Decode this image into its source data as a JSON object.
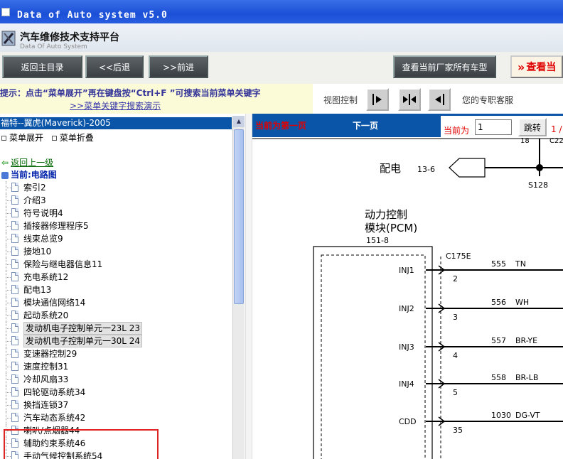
{
  "window": {
    "title": "Data of Auto system v5.0"
  },
  "header": {
    "title": "汽车维修技术支持平台",
    "subtitle": "Data Of Auto System"
  },
  "toolbar": {
    "home_label": "返回主目录",
    "back_label": "<<后退",
    "forward_label": ">>前进",
    "all_models_label": "查看当前厂家所有车型",
    "hot_label": "查看当"
  },
  "tips": {
    "hint": "提示：点击“菜单展开”再在键盘按“Ctrl+F ”可搜索当前菜单关键字",
    "demo_link": ">>菜单关键字搜索演示",
    "view_control": "视图控制",
    "support": "您的专职客服"
  },
  "left": {
    "vehicle": "福特--翼虎(Maverick)-2005",
    "expand_label": "菜单展开",
    "collapse_label": "菜单折叠",
    "back_up": "返回上一级",
    "current": "当前:电路图",
    "items": [
      {
        "label": "索引2"
      },
      {
        "label": "介绍3"
      },
      {
        "label": "符号说明4"
      },
      {
        "label": "插接器修理程序5"
      },
      {
        "label": "线束总览9"
      },
      {
        "label": "接地10"
      },
      {
        "label": "保险与继电器信息11"
      },
      {
        "label": "充电系统12"
      },
      {
        "label": "配电13"
      },
      {
        "label": "模块通信网络14"
      },
      {
        "label": "起动系统20"
      },
      {
        "label": "发动机电子控制单元一23L 23"
      },
      {
        "label": "发动机电子控制单元一30L 24"
      },
      {
        "label": "变速器控制29"
      },
      {
        "label": "速度控制31"
      },
      {
        "label": "冷却风扇33"
      },
      {
        "label": "四轮驱动系统34"
      },
      {
        "label": "换挡连锁37"
      },
      {
        "label": "汽车动态系统42"
      },
      {
        "label": "喇叭/点烟器44"
      },
      {
        "label": "辅助约束系统46"
      },
      {
        "label": "手动气候控制系统54"
      }
    ]
  },
  "right": {
    "first_page": "当前为第一页",
    "next_page": "下一页",
    "current_label": "当前为",
    "page_value": "1",
    "jump_label": "跳转",
    "total_label": "1 /"
  },
  "diagram": {
    "top_label_1": "18",
    "top_label_2": "C22",
    "power_label": "配电",
    "power_ref": "13-6",
    "splice": "S128",
    "pcm_title_1": "动力控制",
    "pcm_title_2": "模块(PCM)",
    "pcm_ref": "151-8",
    "connector": "C175E",
    "pins": [
      {
        "name": "INJ1",
        "pin": "2",
        "circuit": "555",
        "color": "TN"
      },
      {
        "name": "INJ2",
        "pin": "3",
        "circuit": "556",
        "color": "WH"
      },
      {
        "name": "INJ3",
        "pin": "4",
        "circuit": "557",
        "color": "BR-YE"
      },
      {
        "name": "INJ4",
        "pin": "5",
        "circuit": "558",
        "color": "BR-LB"
      },
      {
        "name": "CDD",
        "pin": "35",
        "circuit": "1030",
        "color": "DG-VT"
      }
    ]
  }
}
